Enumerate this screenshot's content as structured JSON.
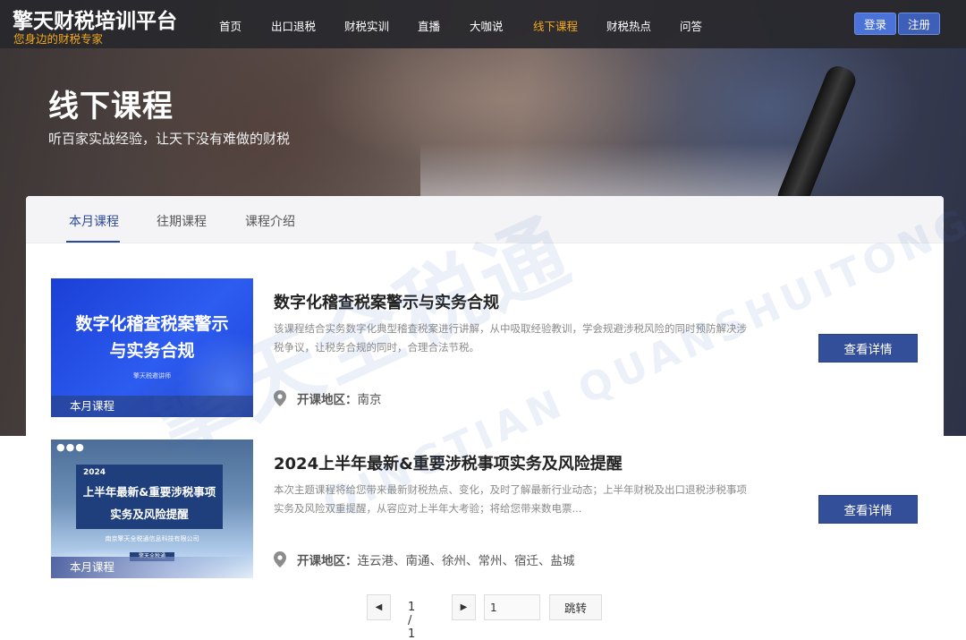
{
  "header": {
    "brand_title": "擎天财税培训平台",
    "brand_subtitle": "您身边的财税专家",
    "nav": [
      {
        "label": "首页",
        "active": false
      },
      {
        "label": "出口退税",
        "active": false
      },
      {
        "label": "财税实训",
        "active": false
      },
      {
        "label": "直播",
        "active": false
      },
      {
        "label": "大咖说",
        "active": false
      },
      {
        "label": "线下课程",
        "active": true
      },
      {
        "label": "财税热点",
        "active": false
      },
      {
        "label": "问答",
        "active": false
      }
    ],
    "login_label": "登录",
    "register_label": "注册"
  },
  "hero": {
    "title": "线下课程",
    "subtitle": "听百家实战经验，让天下没有难做的财税"
  },
  "tabs": [
    {
      "label": "本月课程",
      "active": true
    },
    {
      "label": "往期课程",
      "active": false
    },
    {
      "label": "课程介绍",
      "active": false
    }
  ],
  "courses": [
    {
      "title": "数字化稽查税案警示与实务合规",
      "description": "该课程结合实务数字化典型稽查税案进行讲解，从中吸取经验教训，学会规避涉税风险的同时预防解决涉税争议，让税务合规的同时，合理合法节税。",
      "location_label": "开课地区：",
      "location": "南京",
      "badge": "本月课程",
      "detail_label": "查看详情",
      "thumb_title": "数字化稽查税案警示与实务合规",
      "thumb_small": "擎天税邀讲师"
    },
    {
      "title": "2024上半年最新&重要涉税事项实务及风险提醒",
      "description": "本次主题课程将给您带来最新财税热点、变化，及时了解最新行业动态；上半年财税及出口退税涉税事项实务及风险双重提醒，从容应对上半年大考验；将给您带来数电票...",
      "location_label": "开课地区：",
      "location": "连云港、南通、徐州、常州、宿迁、盐城",
      "badge": "本月课程",
      "detail_label": "查看详情",
      "thumb_year": "2024",
      "thumb_title": "上半年最新&重要涉税事项实务及风险提醒",
      "thumb_company": "南京擎天全税通信息科技有限公司",
      "thumb_stamp": "擎天全税通"
    }
  ],
  "watermark": {
    "text": "擎天全税通",
    "latin": "QINGTIAN QUANSHUITONG"
  },
  "pagination": {
    "prev_icon": "◀",
    "next_icon": "▶",
    "info": "1 / 1",
    "page_input": "1",
    "go_label": "跳转"
  },
  "colors": {
    "accent_orange": "#f2a81d",
    "primary_blue": "#344f99",
    "header_bg": "#28282c"
  }
}
